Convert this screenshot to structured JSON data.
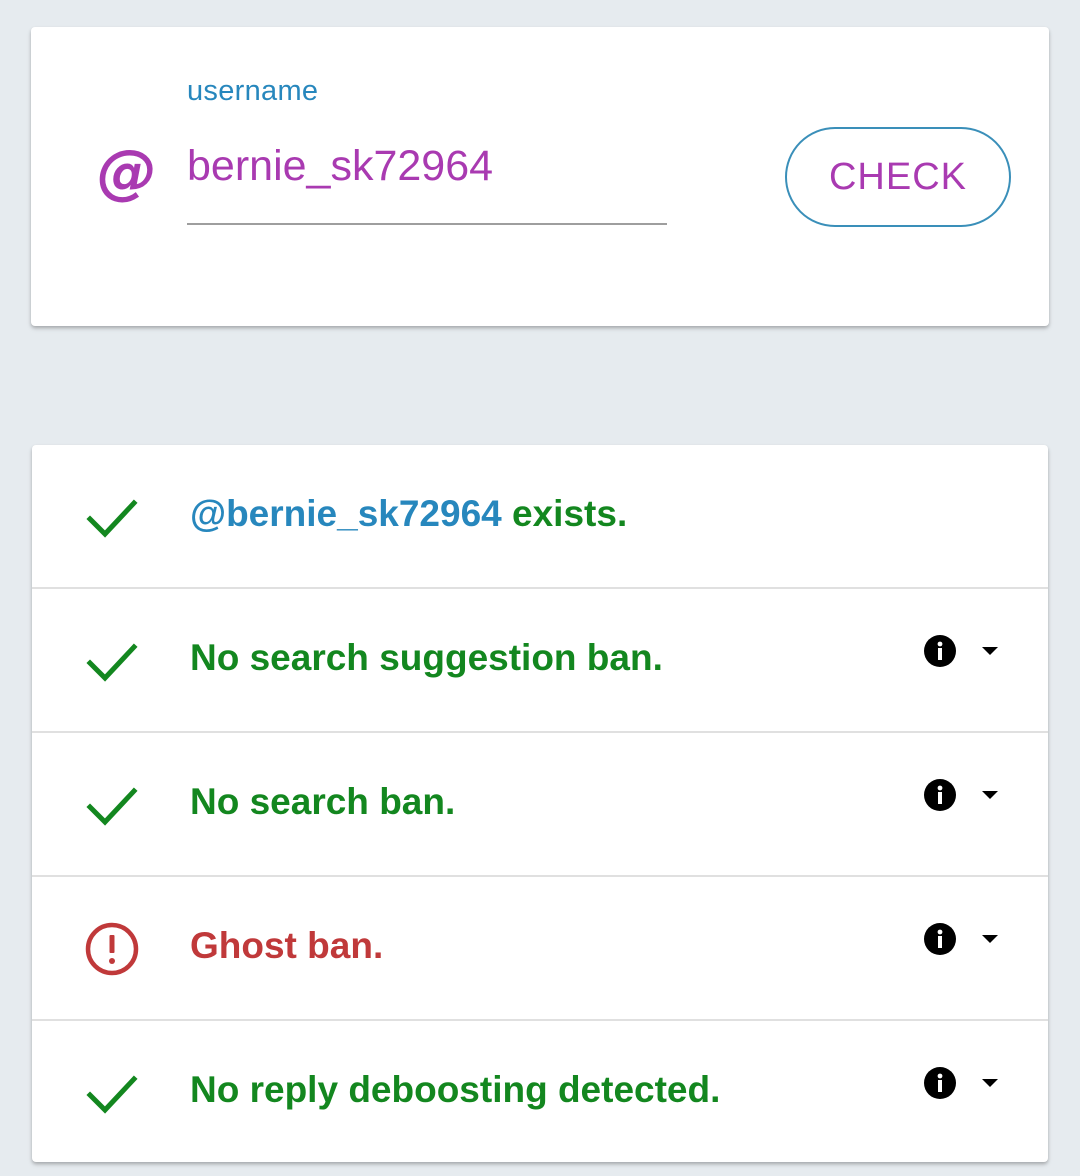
{
  "search": {
    "label": "username",
    "value": "bernie_sk72964",
    "at_symbol": "@",
    "check_label": "CHECK"
  },
  "results": {
    "exists": {
      "handle": "@bernie_sk72964",
      "suffix": " exists.",
      "status": "ok"
    },
    "items": [
      {
        "text": "No search suggestion ban.",
        "status": "ok"
      },
      {
        "text": "No search ban.",
        "status": "ok"
      },
      {
        "text": "Ghost ban.",
        "status": "warning"
      },
      {
        "text": "No reply deboosting detected.",
        "status": "ok"
      }
    ]
  },
  "colors": {
    "accent": "#a93ab1",
    "primary": "#2787bd",
    "ok": "#13871f",
    "warning": "#c0393a",
    "background": "#e6ebef"
  },
  "icons": {
    "ok": "check-icon",
    "warning": "alert-circle-icon",
    "info": "info-icon",
    "expand": "caret-down-icon"
  }
}
